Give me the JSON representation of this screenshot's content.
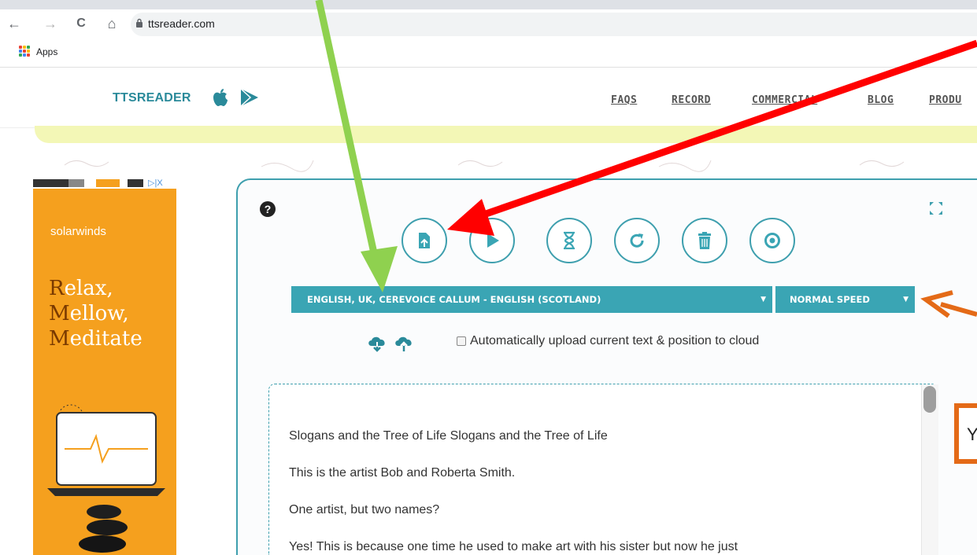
{
  "browser": {
    "url": "ttsreader.com",
    "bookmarks_apps_label": "Apps",
    "back_glyph": "←",
    "forward_glyph": "→",
    "reload_glyph": "C",
    "home_glyph": "⌂"
  },
  "site": {
    "logo_text": "TTSREADER",
    "nav": [
      "FAQS",
      "RECORD",
      "COMMERCIAL",
      "BLOG",
      "PRODU"
    ]
  },
  "ad": {
    "brand": "solarwinds",
    "lines": [
      {
        "first": "R",
        "rest": "elax,"
      },
      {
        "first": "M",
        "rest": "ellow,"
      },
      {
        "first": "M",
        "rest": "editate"
      }
    ],
    "badge": "▷|X"
  },
  "player": {
    "help": "?",
    "voice": "ENGLISH, UK, CEREVOICE CALLUM - ENGLISH (SCOTLAND)",
    "speed": "NORMAL SPEED",
    "caret": "▼",
    "auto_upload_label": "Automatically upload current text & position to cloud",
    "auto_upload_checked": false,
    "paragraphs": [
      "Slogans and the Tree of Life Slogans and the Tree of Life",
      "This is the artist Bob and Roberta Smith.",
      "One artist, but two names?",
      "Yes! This is because one time he used to make art with his sister but now he just"
    ]
  },
  "callout": {
    "text": "Y"
  },
  "colors": {
    "teal": "#3aa5b4",
    "ad_orange": "#f5a01e",
    "arrow_green": "#8fd14f",
    "arrow_red": "#ff0000",
    "arrow_orange": "#e46a17"
  },
  "icons": [
    "lock-icon",
    "apps-grid-icon",
    "apple-icon",
    "google-play-icon",
    "help-icon",
    "fullscreen-icon",
    "import-file-icon",
    "play-icon",
    "hourglass-icon",
    "reload-icon",
    "trash-icon",
    "record-icon",
    "cloud-download-icon",
    "cloud-upload-icon"
  ]
}
